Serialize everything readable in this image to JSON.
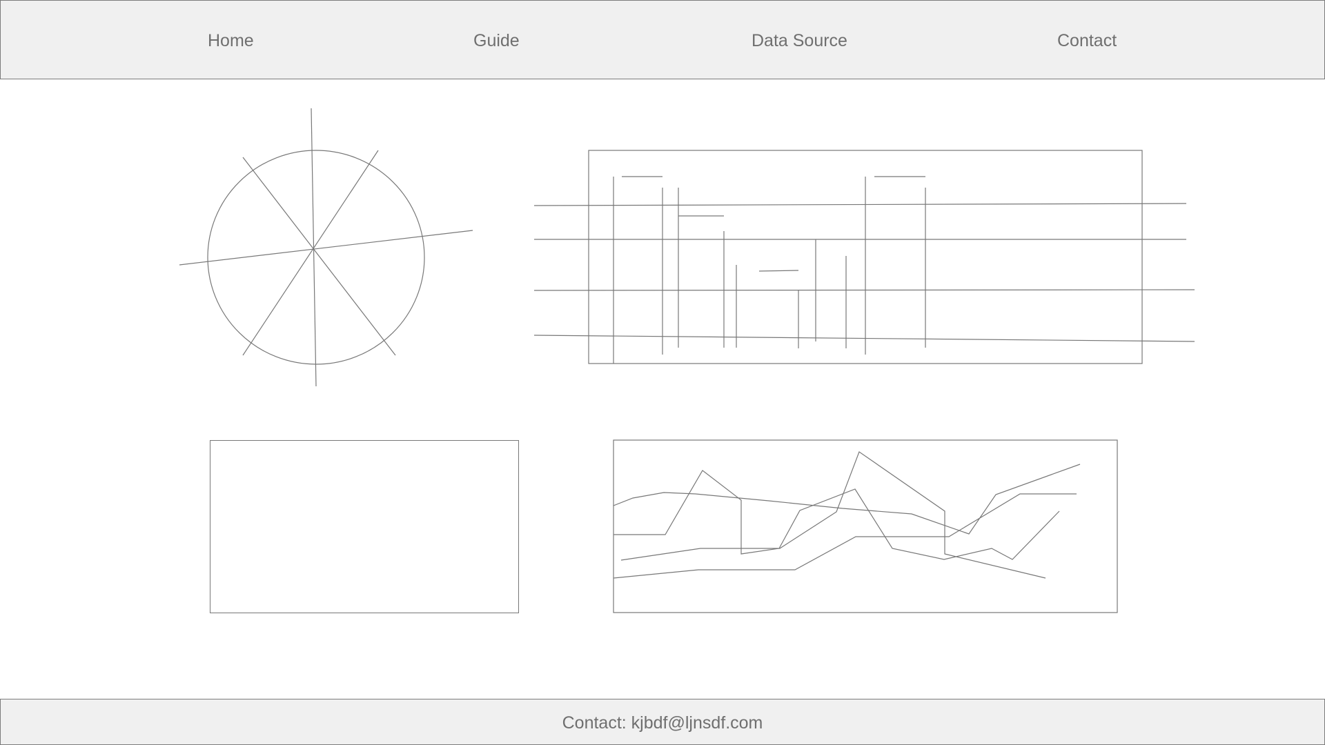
{
  "nav": {
    "items": [
      {
        "label": "Home"
      },
      {
        "label": "Guide"
      },
      {
        "label": "Data Source"
      },
      {
        "label": "Contact"
      }
    ]
  },
  "footer": {
    "text": "Contact: kjbdf@ljnsdf.com"
  },
  "colors": {
    "bar_background": "#f0f0f0",
    "line": "#777777",
    "text": "#6f6f6f"
  }
}
